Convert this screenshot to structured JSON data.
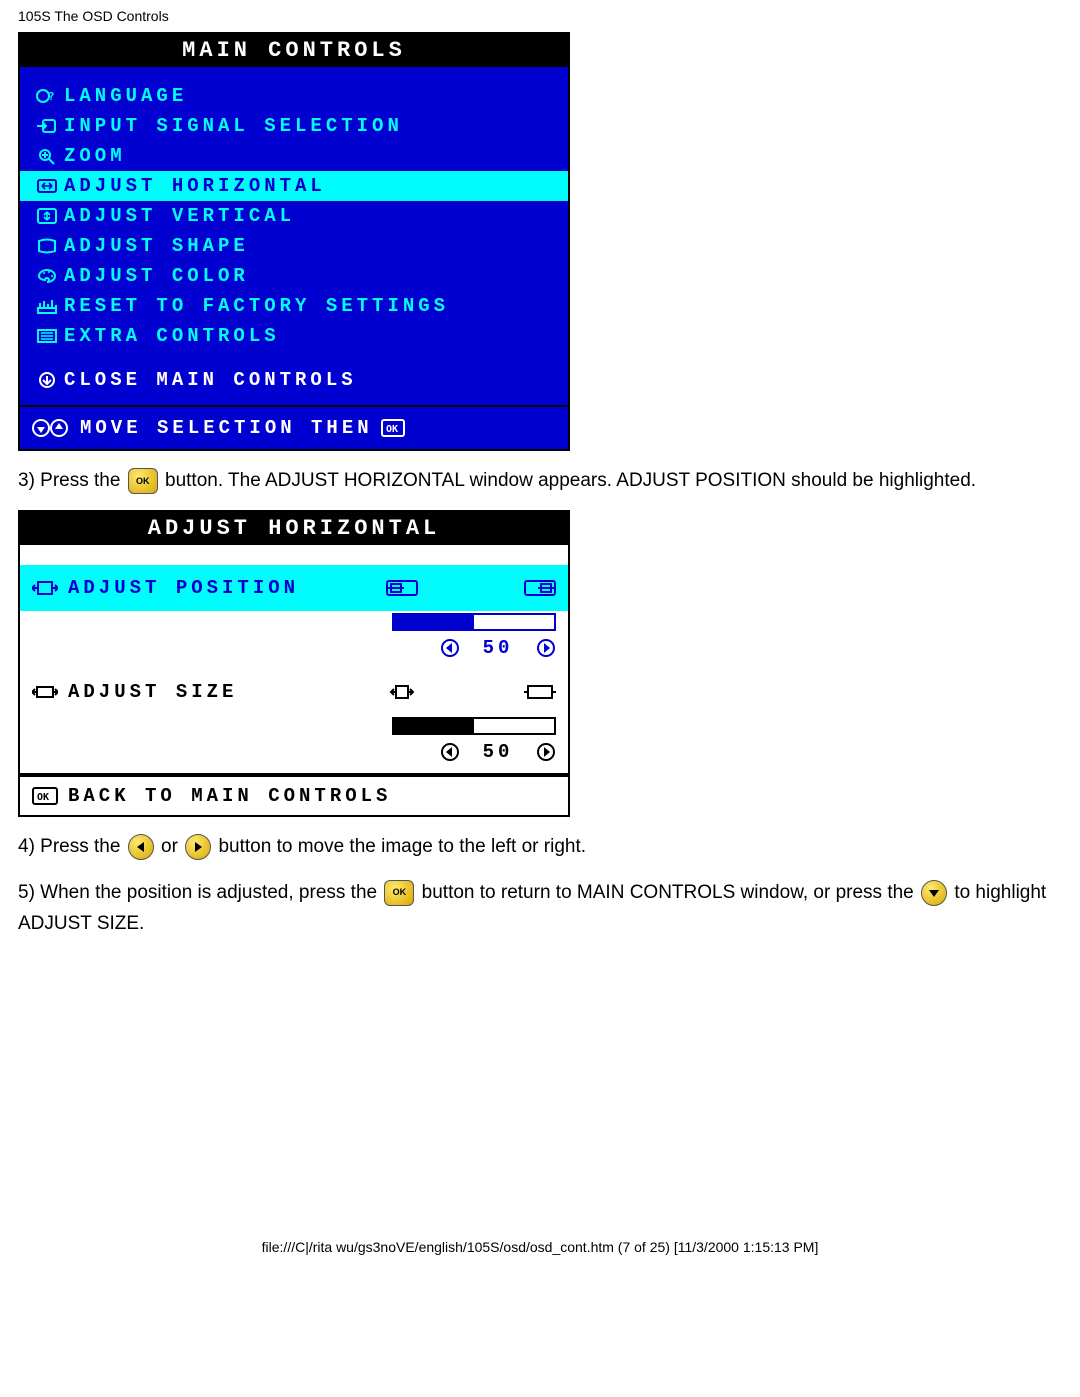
{
  "page": {
    "header": "105S The OSD Controls",
    "footer": "file:///C|/rita wu/gs3noVE/english/105S/osd/osd_cont.htm (7 of 25) [11/3/2000 1:15:13 PM]"
  },
  "main_controls": {
    "title": "MAIN CONTROLS",
    "items": [
      {
        "label": "LANGUAGE",
        "icon": "language-icon"
      },
      {
        "label": "INPUT SIGNAL SELECTION",
        "icon": "input-icon"
      },
      {
        "label": "ZOOM",
        "icon": "zoom-icon"
      },
      {
        "label": "ADJUST HORIZONTAL",
        "icon": "adjust-h-icon",
        "selected": true
      },
      {
        "label": "ADJUST VERTICAL",
        "icon": "adjust-v-icon"
      },
      {
        "label": "ADJUST SHAPE",
        "icon": "adjust-shape-icon"
      },
      {
        "label": "ADJUST COLOR",
        "icon": "adjust-color-icon"
      },
      {
        "label": "RESET TO FACTORY SETTINGS",
        "icon": "reset-icon"
      },
      {
        "label": "EXTRA CONTROLS",
        "icon": "extra-icon"
      }
    ],
    "close_label": "CLOSE MAIN CONTROLS",
    "footer_hint": "MOVE SELECTION THEN",
    "footer_ok": "OK"
  },
  "instructions": {
    "step3_a": "3) Press the ",
    "step3_b": " button. The ADJUST HORIZONTAL window appears. ADJUST POSITION should be highlighted.",
    "step4_a": "4) Press the ",
    "step4_b": " or ",
    "step4_c": " button to move the image to the left or right.",
    "step5_a": "5) When the position is adjusted, press the ",
    "step5_b": " button to return to MAIN CONTROLS window, or press the ",
    "step5_c": " to highlight ADJUST SIZE."
  },
  "adjust_horizontal": {
    "title": "ADJUST HORIZONTAL",
    "rows": [
      {
        "label": "ADJUST POSITION",
        "value": "50",
        "selected": true
      },
      {
        "label": "ADJUST SIZE",
        "value": "50",
        "selected": false
      }
    ],
    "back_label": "BACK TO MAIN CONTROLS"
  }
}
